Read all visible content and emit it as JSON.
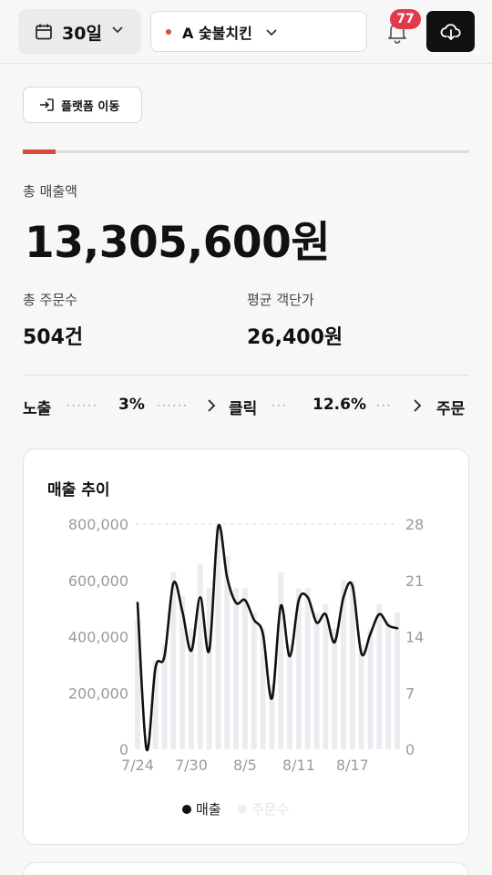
{
  "header": {
    "period_label": "30일",
    "store_name": "A 숯불치킨",
    "notification_count": "77"
  },
  "platform_button_label": "플랫폼 이동",
  "summary": {
    "total_sales_label": "총 매출액",
    "total_sales_value": "13,305,600원",
    "total_orders_label": "총 주문수",
    "total_orders_value": "504건",
    "avg_order_label": "평균 객단가",
    "avg_order_value": "26,400원"
  },
  "funnel": {
    "impression_label": "노출",
    "impression_to_click_rate": "3%",
    "click_label": "클릭",
    "click_to_order_rate": "12.6%",
    "order_label": "주문"
  },
  "sales_trend": {
    "title": "매출 추이"
  },
  "colors": {
    "accent": "#d64a3a",
    "badge": "#e23a4a",
    "sales_line": "#111111",
    "order_bars": "#ececf0"
  },
  "chart_data": {
    "type": "line",
    "x": [
      "7/24",
      "7/25",
      "7/26",
      "7/27",
      "7/28",
      "7/29",
      "7/30",
      "7/31",
      "8/1",
      "8/2",
      "8/3",
      "8/4",
      "8/5",
      "8/6",
      "8/7",
      "8/8",
      "8/9",
      "8/10",
      "8/11",
      "8/12",
      "8/13",
      "8/14",
      "8/15",
      "8/16",
      "8/17",
      "8/18",
      "8/19",
      "8/20",
      "8/21",
      "8/22"
    ],
    "x_tick_labels": [
      "7/24",
      "7/30",
      "8/5",
      "8/11",
      "8/17"
    ],
    "series": [
      {
        "name": "매출",
        "axis": "left",
        "values": [
          520000,
          0,
          290000,
          330000,
          590000,
          490000,
          350000,
          540000,
          350000,
          790000,
          610000,
          520000,
          530000,
          460000,
          410000,
          180000,
          510000,
          330000,
          530000,
          540000,
          450000,
          480000,
          380000,
          540000,
          580000,
          340000,
          410000,
          480000,
          440000,
          430000
        ]
      },
      {
        "name": "주문수",
        "axis": "right",
        "values": [
          16,
          0,
          11,
          13,
          22,
          19,
          15,
          23,
          20,
          28,
          24,
          20,
          20,
          17,
          15,
          8,
          22,
          13,
          20,
          20,
          17,
          18,
          15,
          21,
          21,
          13,
          15,
          18,
          16,
          17
        ]
      }
    ],
    "y_left_ticks": [
      "800,000",
      "600,000",
      "400,000",
      "200,000",
      "0"
    ],
    "y_right_ticks": [
      "28",
      "21",
      "14",
      "7",
      "0"
    ],
    "ylim_left": [
      0,
      800000
    ],
    "ylim_right": [
      0,
      28
    ],
    "legend_position": "bottom"
  }
}
